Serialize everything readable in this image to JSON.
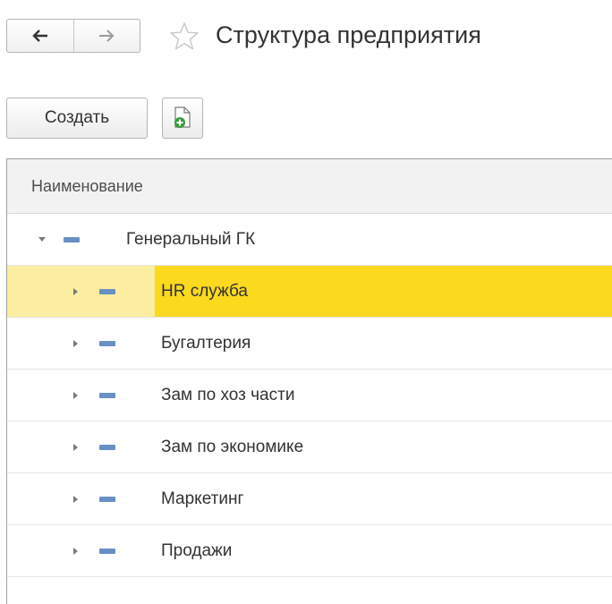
{
  "window": {
    "title": "Структура предприятия"
  },
  "nav": {
    "back_icon": "arrow-left-icon",
    "forward_icon": "arrow-right-icon",
    "favorite_icon": "star-outline-icon"
  },
  "toolbar": {
    "create_label": "Создать",
    "add_icon": "document-add-icon"
  },
  "table": {
    "column_header": "Наименование",
    "root": {
      "label": "Генеральный ГК",
      "expanded": true
    },
    "children": [
      {
        "label": "HR служба",
        "selected": true
      },
      {
        "label": "Бугалтерия",
        "selected": false
      },
      {
        "label": "Зам по хоз части",
        "selected": false
      },
      {
        "label": "Зам по экономике",
        "selected": false
      },
      {
        "label": "Маркетинг",
        "selected": false
      },
      {
        "label": "Продажи",
        "selected": false
      }
    ]
  },
  "colors": {
    "selection_row": "#fbeea0",
    "selection_cell": "#fad91f",
    "node_icon": "#6a8fc4"
  }
}
